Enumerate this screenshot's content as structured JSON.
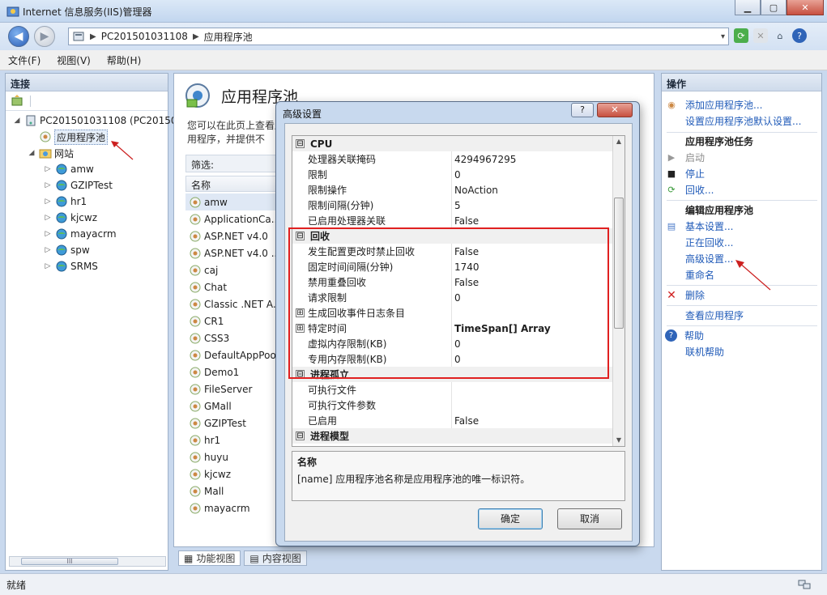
{
  "window": {
    "title": "Internet 信息服务(IIS)管理器"
  },
  "address": {
    "path": [
      "PC201501031108",
      "应用程序池"
    ]
  },
  "menu": [
    "文件(F)",
    "视图(V)",
    "帮助(H)"
  ],
  "connections": {
    "header": "连接",
    "server": "PC201501031108 (PC20150",
    "app_pools": "应用程序池",
    "sites": "网站",
    "site_items": [
      "amw",
      "GZIPTest",
      "hr1",
      "kjcwz",
      "mayacrm",
      "spw",
      "SRMS"
    ],
    "scroll_text": "III"
  },
  "center": {
    "title": "应用程序池",
    "description": "您可以在此页上查看应用程序，并提供不",
    "filter_label": "筛选:",
    "col_name": "名称",
    "pools": [
      "amw",
      "ApplicationCa...",
      "ASP.NET v4.0",
      "ASP.NET v4.0 ...",
      "caj",
      "Chat",
      "Classic .NET A...",
      "CR1",
      "CSS3",
      "DefaultAppPoo",
      "Demo1",
      "FileServer",
      "GMall",
      "GZIPTest",
      "hr1",
      "huyu",
      "kjcwz",
      "Mall",
      "mayacrm"
    ],
    "tabs": [
      "功能视图",
      "内容视图"
    ]
  },
  "actions": {
    "header": "操作",
    "add_pool": "添加应用程序池...",
    "set_defaults": "设置应用程序池默认设置...",
    "tasks_head": "应用程序池任务",
    "start": "启动",
    "stop": "停止",
    "recycle": "回收...",
    "edit_head": "编辑应用程序池",
    "basic": "基本设置...",
    "recycling": "正在回收...",
    "advanced": "高级设置...",
    "rename": "重命名",
    "delete": "删除",
    "view_apps": "查看应用程序",
    "help": "帮助",
    "online_help": "联机帮助"
  },
  "status": {
    "text": "就绪"
  },
  "dialog": {
    "title": "高级设置",
    "help_btn": "?",
    "close_btn": "✕",
    "rows": [
      {
        "kind": "cat",
        "name": "CPU",
        "toggle": "⊟"
      },
      {
        "kind": "prop",
        "name": "处理器关联掩码",
        "value": "4294967295"
      },
      {
        "kind": "prop",
        "name": "限制",
        "value": "0"
      },
      {
        "kind": "prop",
        "name": "限制操作",
        "value": "NoAction"
      },
      {
        "kind": "prop",
        "name": "限制间隔(分钟)",
        "value": "5"
      },
      {
        "kind": "prop",
        "name": "已启用处理器关联",
        "value": "False"
      },
      {
        "kind": "cat",
        "name": "回收",
        "toggle": "⊟"
      },
      {
        "kind": "prop",
        "name": "发生配置更改时禁止回收",
        "value": "False"
      },
      {
        "kind": "prop",
        "name": "固定时间间隔(分钟)",
        "value": "1740"
      },
      {
        "kind": "prop",
        "name": "禁用重叠回收",
        "value": "False"
      },
      {
        "kind": "prop",
        "name": "请求限制",
        "value": "0"
      },
      {
        "kind": "sub",
        "name": "生成回收事件日志条目",
        "value": "",
        "toggle": "⊞"
      },
      {
        "kind": "sub",
        "name": "特定时间",
        "value": "TimeSpan[] Array",
        "toggle": "⊞",
        "bold": true
      },
      {
        "kind": "prop",
        "name": "虚拟内存限制(KB)",
        "value": "0"
      },
      {
        "kind": "prop",
        "name": "专用内存限制(KB)",
        "value": "0"
      },
      {
        "kind": "cat",
        "name": "进程孤立",
        "toggle": "⊟"
      },
      {
        "kind": "prop",
        "name": "可执行文件",
        "value": ""
      },
      {
        "kind": "prop",
        "name": "可执行文件参数",
        "value": ""
      },
      {
        "kind": "prop",
        "name": "已启用",
        "value": "False"
      },
      {
        "kind": "cat",
        "name": "进程模型",
        "toggle": "⊟"
      }
    ],
    "desc_title": "名称",
    "desc_text": "[name] 应用程序池名称是应用程序池的唯一标识符。",
    "ok": "确定",
    "cancel": "取消"
  },
  "colors": {
    "highlight": "#e02020",
    "link": "#1f5ab8"
  }
}
